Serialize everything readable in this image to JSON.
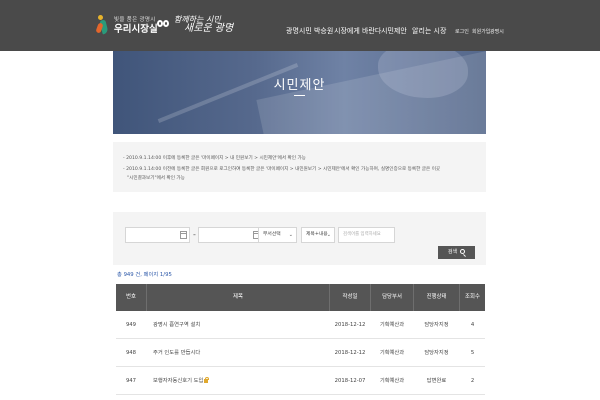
{
  "header": {
    "logo_small": "빛을 품은 광명시",
    "logo_big": "우리시장실",
    "slogan_line1": "함께하는 시민",
    "slogan_line2": "새로운 광명",
    "nav": [
      "광명시민 박승원",
      "시장에게 바란다",
      "시민제안",
      "알리는 시장"
    ],
    "util": [
      "로그인",
      "회원가입",
      "광명시"
    ]
  },
  "banner": {
    "title": "시민제안"
  },
  "notice": {
    "lines": [
      "- 2010.9.1.14:00 이후에 등록한 글은 '마이페이지 > 내 민원보기 > 시민제안'에서 확인 가능",
      "- 2010.9.1.14:00 이전에 등록한 글은 회원으로 로그인하여 등록한 글은 '마이페이지 > 내민원보기 > 시민제안'에서 확인 가능하며, 실명인증으로 등록한 글은 이곳",
      "\"시민결과보기\"에서 확인 가능"
    ]
  },
  "search": {
    "date_from": "",
    "date_to": "",
    "dept_select": "부서선택",
    "field_select": "제목+내용",
    "keyword_placeholder": "검색어를 입력하세요",
    "button_label": "검색"
  },
  "count": {
    "prefix": "총 ",
    "total": "949",
    "mid": " 건, 페이지 ",
    "page": "1/95"
  },
  "table": {
    "headers": [
      "번호",
      "제목",
      "작성일",
      "담당부서",
      "진행상태",
      "조회수"
    ],
    "rows": [
      {
        "no": "949",
        "title": "광명시 흡연구역 설치",
        "date": "2018-12-12",
        "dept": "기획예산과",
        "status": "담당자지정",
        "views": "4",
        "locked": false
      },
      {
        "no": "948",
        "title": "주거 인도를 만듭시다",
        "date": "2018-12-12",
        "dept": "기획예산과",
        "status": "담당자지정",
        "views": "5",
        "locked": false
      },
      {
        "no": "947",
        "title": "보행자자동신호기 도입",
        "date": "2018-12-07",
        "dept": "기획예산과",
        "status": "답변완료",
        "views": "2",
        "locked": true
      }
    ]
  },
  "colors": {
    "header_bg": "#4a4a4a",
    "table_header_bg": "#555555",
    "count_text": "#2b57a8",
    "lock_icon": "#e0a82e"
  },
  "icons": [
    "calendar-icon",
    "chevron-down-icon",
    "search-icon",
    "lock-icon"
  ]
}
